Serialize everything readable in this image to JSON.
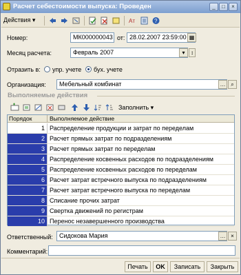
{
  "window": {
    "title": "Расчет себестоимости выпуска: Проведен"
  },
  "toolbar": {
    "actions_label": "Действия ▾"
  },
  "form": {
    "number_label": "Номер:",
    "number_value": "МК000000043",
    "from_label": "от:",
    "date_value": "28.02.2007 23:59:00",
    "month_label": "Месяц расчета:",
    "month_value": "Февраль 2007",
    "reflect_label": "Отразить в:",
    "radio_mgmt_label": "упр. учете",
    "radio_acct_label": "бух. учете",
    "org_label": "Организация:",
    "org_value": "Мебельный комбинат",
    "section_title": "Выполняемые действия",
    "fill_label": "Заполнить ▾",
    "responsible_label": "Ответственный:",
    "responsible_value": "Сидокова Мария",
    "comment_label": "Комментарий:",
    "comment_value": ""
  },
  "table": {
    "col_order": "Порядок",
    "col_action": "Выполняемое действие",
    "rows": [
      {
        "n": "1",
        "a": "Распределение продукции и затрат по переделам"
      },
      {
        "n": "2",
        "a": "Расчет прямых затрат по подразделениям"
      },
      {
        "n": "3",
        "a": "Расчет прямых затрат по переделам"
      },
      {
        "n": "4",
        "a": "Распределение косвенных расходов по подразделениям"
      },
      {
        "n": "5",
        "a": "Распределение косвенных расходов по переделам"
      },
      {
        "n": "6",
        "a": "Расчет затрат встречного выпуска по подразделениям"
      },
      {
        "n": "7",
        "a": "Расчет затрат встречного выпуска по переделам"
      },
      {
        "n": "8",
        "a": "Списание прочих затрат"
      },
      {
        "n": "9",
        "a": "Свертка движений по регистрам"
      },
      {
        "n": "10",
        "a": "Перенос незавершенного производства"
      }
    ]
  },
  "footer": {
    "print": "Печать",
    "ok": "OK",
    "save": "Записать",
    "close": "Закрыть"
  }
}
